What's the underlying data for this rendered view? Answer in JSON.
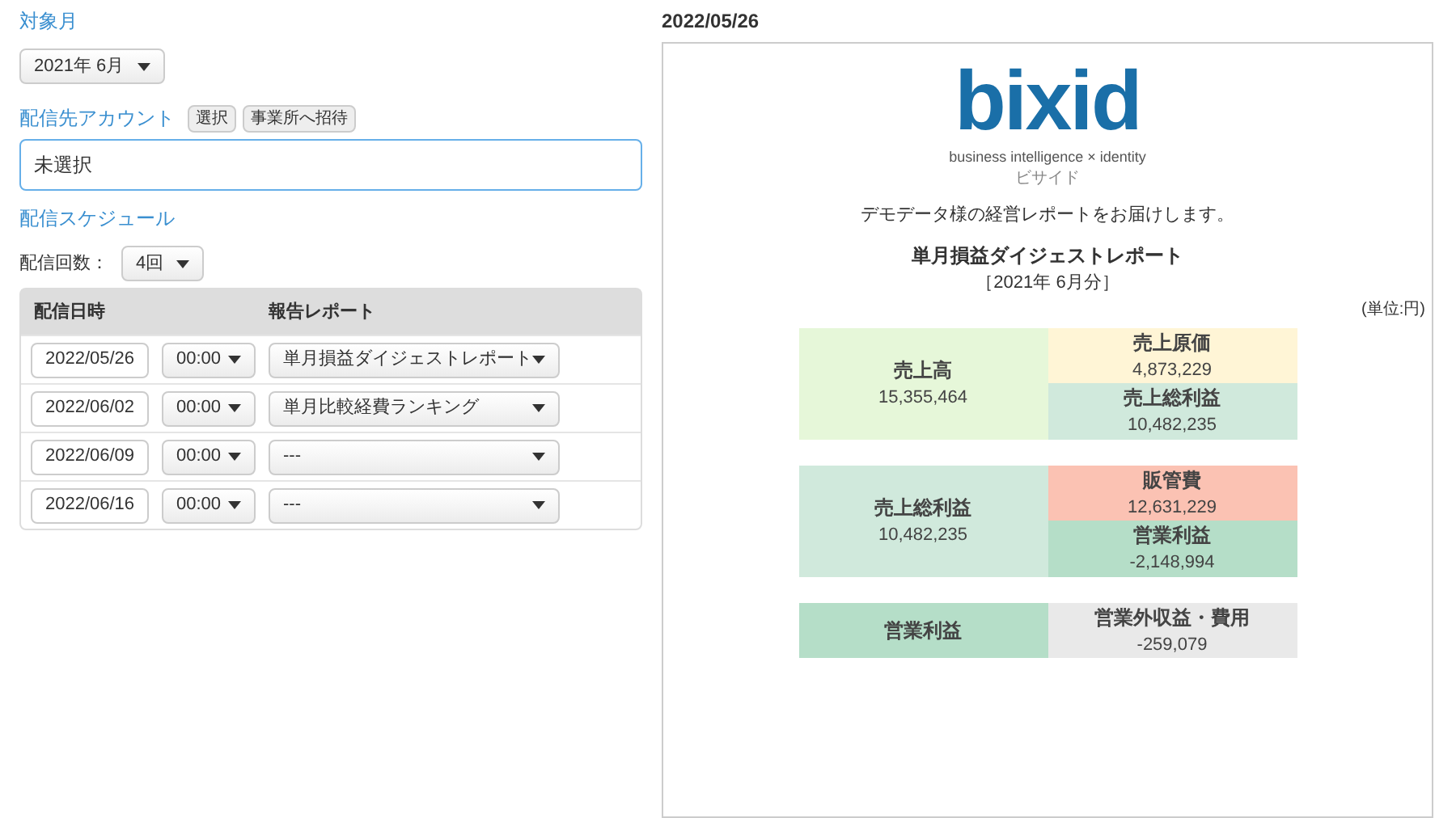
{
  "target_month": {
    "label": "対象月",
    "value": "2021年 6月"
  },
  "account": {
    "label": "配信先アカウント",
    "buttons": [
      "選択",
      "事業所へ招待"
    ],
    "value": "未選択"
  },
  "schedule": {
    "label": "配信スケジュール",
    "count_label": "配信回数：",
    "count": "4回",
    "columns": [
      "配信日時",
      "報告レポート"
    ],
    "rows": [
      {
        "date": "2022/05/26",
        "time": "00:00",
        "report": "単月損益ダイジェストレポート"
      },
      {
        "date": "2022/06/02",
        "time": "00:00",
        "report": "単月比較経費ランキング"
      },
      {
        "date": "2022/06/09",
        "time": "00:00",
        "report": "---"
      },
      {
        "date": "2022/06/16",
        "time": "00:00",
        "report": "---"
      }
    ]
  },
  "preview": {
    "date": "2022/05/26",
    "logo": {
      "text": "bixid",
      "tagline": "business intelligence × identity",
      "reading": "ビサイド"
    },
    "greeting": "デモデータ様の経営レポートをお届けします。",
    "title": "単月損益ダイジェストレポート",
    "period": "［2021年 6月分］",
    "unit": "(単位:円)",
    "blocks": [
      {
        "left": {
          "label": "売上高",
          "value": "15,355,464",
          "color": "#e6f7d9"
        },
        "right": [
          {
            "label": "売上原価",
            "value": "4,873,229",
            "color": "#fff5d6"
          },
          {
            "label": "売上総利益",
            "value": "10,482,235",
            "color": "#d0e9dc"
          }
        ]
      },
      {
        "left": {
          "label": "売上総利益",
          "value": "10,482,235",
          "color": "#d0e9dc"
        },
        "right": [
          {
            "label": "販管費",
            "value": "12,631,229",
            "color": "#fbc2b3"
          },
          {
            "label": "営業利益",
            "value": "-2,148,994",
            "color": "#b5dec8"
          }
        ]
      },
      {
        "left": {
          "label": "営業利益",
          "color": "#b5dec8"
        },
        "right": [
          {
            "label": "営業外収益・費用",
            "value": "-259,079",
            "color": "#e9e9e9"
          }
        ]
      }
    ]
  }
}
